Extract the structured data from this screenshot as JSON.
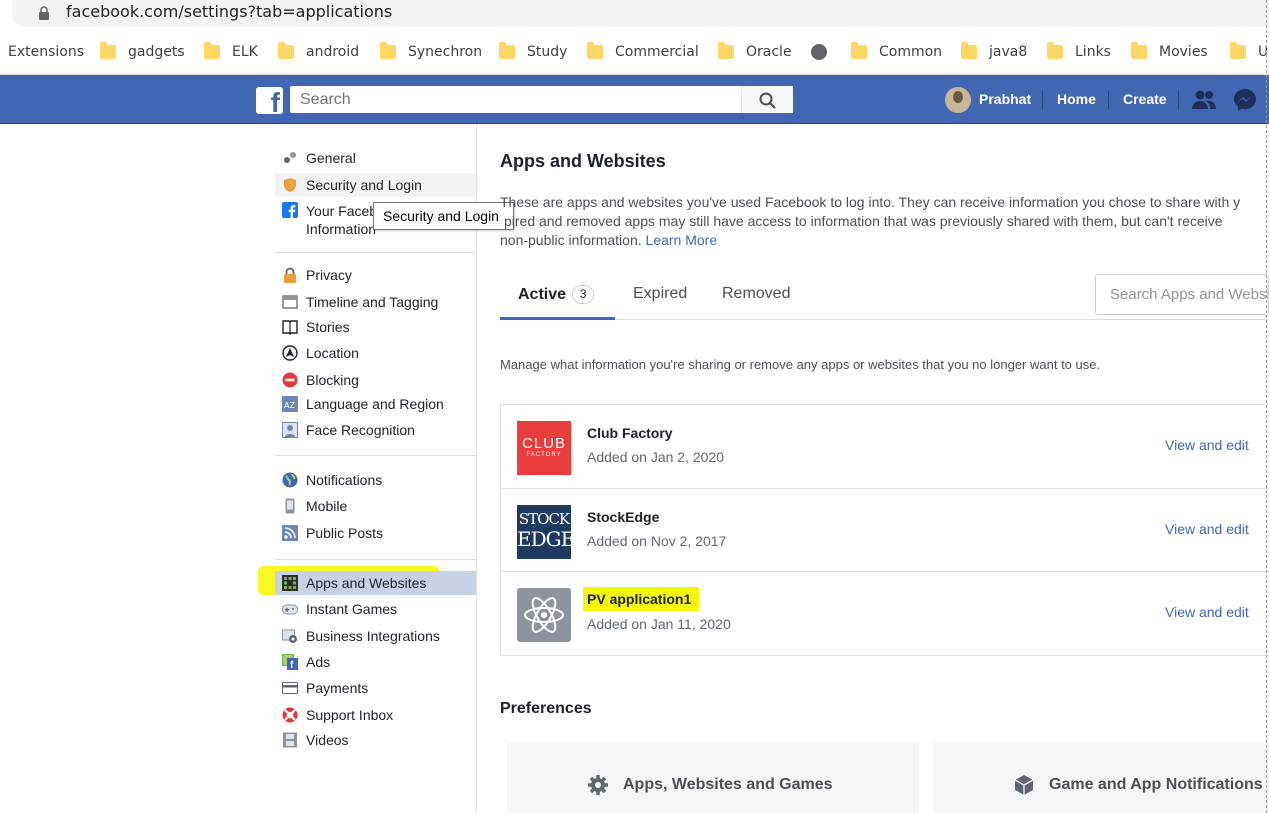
{
  "browser": {
    "url": "facebook.com/settings?tab=applications",
    "bookmarks": [
      "Extensions",
      "gadgets",
      "ELK",
      "android",
      "Synechron",
      "Study",
      "Commercial",
      "Oracle",
      "Common",
      "java8",
      "Links",
      "Movies",
      "U"
    ]
  },
  "header": {
    "search_placeholder": "Search",
    "user_name": "Prabhat",
    "home": "Home",
    "create": "Create"
  },
  "sidebar": {
    "group1": [
      "General",
      "Security and Login",
      "Your Faceb",
      "Information"
    ],
    "group2": [
      "Privacy",
      "Timeline and Tagging",
      "Stories",
      "Location",
      "Blocking",
      "Language and Region",
      "Face Recognition"
    ],
    "group3": [
      "Notifications",
      "Mobile",
      "Public Posts"
    ],
    "group4": [
      "Apps and Websites",
      "Instant Games",
      "Business Integrations",
      "Ads",
      "Payments",
      "Support Inbox",
      "Videos"
    ],
    "tooltip": "Security and Login"
  },
  "main": {
    "title": "Apps and Websites",
    "description": "These are apps and websites you've used Facebook to log into. They can receive information you chose to share with y",
    "description2": "pired and removed apps may still have access to information that was previously shared with them, but can't receive",
    "description3": "non-public information.",
    "learn_more": "Learn More",
    "tabs": {
      "active": "Active",
      "active_count": "3",
      "expired": "Expired",
      "removed": "Removed"
    },
    "search_placeholder": "Search Apps and Websites",
    "manage_text": "Manage what information you're sharing or remove any apps or websites that you no longer want to use.",
    "apps": [
      {
        "name": "Club Factory",
        "added": "Added on Jan 2, 2020",
        "action": "View and edit",
        "logo_line1": "CLUB",
        "logo_line2": "FACTORY"
      },
      {
        "name": "StockEdge",
        "added": "Added on Nov 2, 2017",
        "action": "View and edit",
        "logo_line1": "STOCK",
        "logo_line2": "EDGE"
      },
      {
        "name": "PV application1",
        "added": "Added on Jan 11, 2020",
        "action": "View and edit"
      }
    ],
    "preferences_title": "Preferences",
    "pref_cards": [
      "Apps, Websites and Games",
      "Game and App Notifications"
    ]
  },
  "colors": {
    "fb_blue": "#4267b2",
    "highlight": "#f7f70a",
    "link": "#4267b2"
  }
}
